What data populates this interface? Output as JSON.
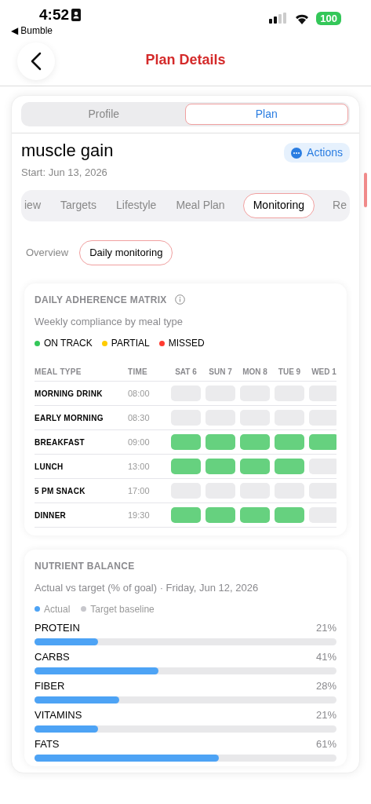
{
  "status_bar": {
    "time": "4:52",
    "back_app": "◀ Bumble",
    "battery": "100"
  },
  "header": {
    "title": "Plan Details"
  },
  "segments": [
    {
      "label": "Profile",
      "selected": false
    },
    {
      "label": "Plan",
      "selected": true
    }
  ],
  "plan": {
    "name": "muscle gain",
    "start": "Start: Jun 13, 2026",
    "actions": "Actions"
  },
  "tabs": [
    {
      "label": "iew",
      "selected": false
    },
    {
      "label": "Targets",
      "selected": false
    },
    {
      "label": "Lifestyle",
      "selected": false
    },
    {
      "label": "Meal Plan",
      "selected": false
    },
    {
      "label": "Monitoring",
      "selected": true
    },
    {
      "label": "Re",
      "selected": false
    }
  ],
  "subtabs": [
    {
      "label": "Overview",
      "selected": false
    },
    {
      "label": "Daily monitoring",
      "selected": true
    }
  ],
  "matrix": {
    "title": "DAILY ADHERENCE MATRIX",
    "subtitle": "Weekly compliance by meal type",
    "legend": [
      {
        "label": "ON TRACK",
        "color": "#34c759"
      },
      {
        "label": "PARTIAL",
        "color": "#ffcc00"
      },
      {
        "label": "MISSED",
        "color": "#ff3b30"
      }
    ],
    "columns": [
      "MEAL TYPE",
      "TIME",
      "SAT 6",
      "SUN 7",
      "MON 8",
      "TUE 9",
      "WED 1"
    ],
    "rows": [
      {
        "meal": "MORNING DRINK",
        "time": "08:00",
        "cells": [
          {
            "on_track": false
          },
          {
            "on_track": false
          },
          {
            "on_track": false
          },
          {
            "on_track": false
          },
          {
            "on_track": false
          }
        ]
      },
      {
        "meal": "EARLY MORNING",
        "time": "08:30",
        "cells": [
          {
            "on_track": false
          },
          {
            "on_track": false
          },
          {
            "on_track": false
          },
          {
            "on_track": false
          },
          {
            "on_track": false
          }
        ]
      },
      {
        "meal": "BREAKFAST",
        "time": "09:00",
        "cells": [
          {
            "on_track": true
          },
          {
            "on_track": true
          },
          {
            "on_track": true
          },
          {
            "on_track": true
          },
          {
            "on_track": true
          }
        ]
      },
      {
        "meal": "LUNCH",
        "time": "13:00",
        "cells": [
          {
            "on_track": true
          },
          {
            "on_track": true
          },
          {
            "on_track": true
          },
          {
            "on_track": true
          },
          {
            "on_track": false
          }
        ]
      },
      {
        "meal": "5 PM SNACK",
        "time": "17:00",
        "cells": [
          {
            "on_track": false
          },
          {
            "on_track": false
          },
          {
            "on_track": false
          },
          {
            "on_track": false
          },
          {
            "on_track": false
          }
        ]
      },
      {
        "meal": "DINNER",
        "time": "19:30",
        "cells": [
          {
            "on_track": true
          },
          {
            "on_track": true
          },
          {
            "on_track": true
          },
          {
            "on_track": true
          },
          {
            "on_track": false
          }
        ]
      }
    ]
  },
  "nutrients": {
    "title": "NUTRIENT BALANCE",
    "subtitle": "Actual vs target (% of goal) · Friday, Jun 12, 2026",
    "legend": [
      {
        "label": "Actual",
        "color": "#4da3f5"
      },
      {
        "label": "Target baseline",
        "color": "#c7c7cc"
      }
    ],
    "items": [
      {
        "name": "PROTEIN",
        "reading": "21%",
        "level": 0.21
      },
      {
        "name": "CARBS",
        "reading": "41%",
        "level": 0.41
      },
      {
        "name": "FIBER",
        "reading": "28%",
        "level": 0.28
      },
      {
        "name": "VITAMINS",
        "reading": "21%",
        "level": 0.21
      },
      {
        "name": "FATS",
        "reading": "61%",
        "level": 0.61
      }
    ]
  }
}
